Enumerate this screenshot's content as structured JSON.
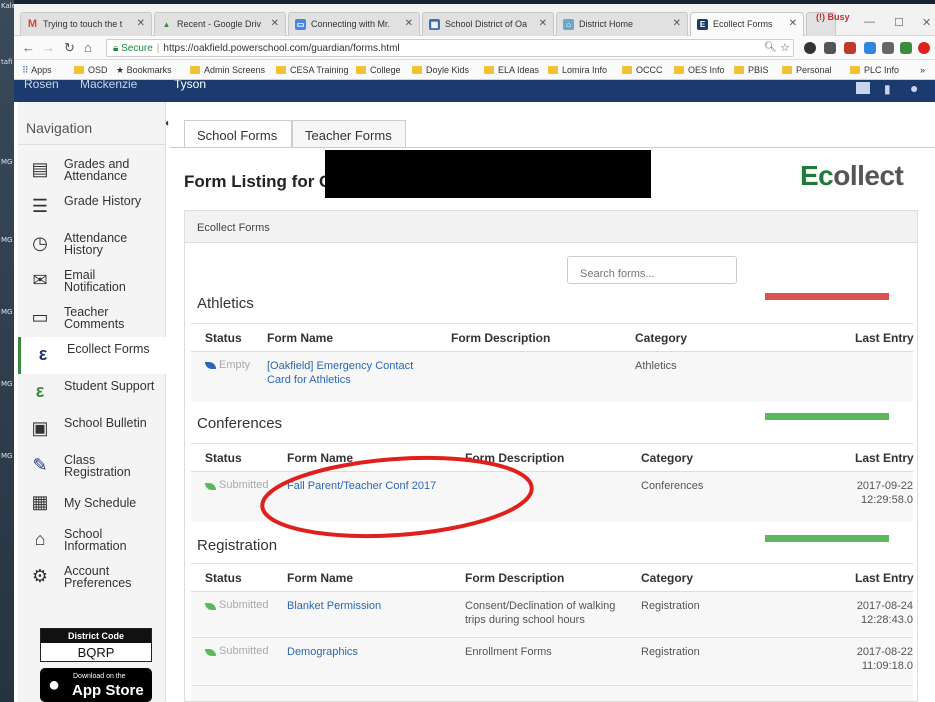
{
  "desktop": {
    "labels": [
      "Kale",
      "tafi",
      "MG",
      "MG",
      "MG",
      "MG",
      "MG"
    ]
  },
  "browser": {
    "tabs": [
      {
        "label": "Trying to touch the t",
        "icon": "gmail-icon",
        "icon_text": "M",
        "color": "#d44638"
      },
      {
        "label": "Recent - Google Driv",
        "icon": "google-drive-icon",
        "icon_text": "▲",
        "color": "#3b8d3b"
      },
      {
        "label": "Connecting with Mr.",
        "icon": "slides-icon",
        "icon_text": "▭",
        "color": "#4a86e8"
      },
      {
        "label": "School District of Oa",
        "icon": "school-site-icon",
        "icon_text": "▦",
        "color": "#3c6fb4"
      },
      {
        "label": "District Home",
        "icon": "district-home-icon",
        "icon_text": "⌂",
        "color": "#6aa7c9"
      },
      {
        "label": "Ecollect Forms",
        "icon": "ecollect-icon",
        "icon_text": "E",
        "color": "#1b3b6e"
      }
    ],
    "profile_label": "(!) Busy",
    "address": {
      "secure_label": "Secure",
      "url": "https://oakfield.powerschool.com/guardian/forms.html"
    },
    "bookmarks": [
      "Apps",
      "OSD",
      "Bookmarks",
      "Admin Screens",
      "CESA Training",
      "College",
      "Doyle Kids",
      "ELA Ideas",
      "Lomira Info",
      "OCCC",
      "OES Info",
      "PBIS",
      "Personal",
      "PLC Info"
    ]
  },
  "topbar": {
    "names": [
      "Rosen",
      "Mackenzie",
      "Tyson"
    ]
  },
  "sidebar": {
    "title": "Navigation",
    "items": [
      {
        "label": "Grades and Attendance",
        "icon": "grades-icon",
        "glyph": "▤"
      },
      {
        "label": "Grade History",
        "icon": "grade-history-icon",
        "glyph": "☰"
      },
      {
        "label": "Attendance History",
        "icon": "attendance-icon",
        "glyph": "◷"
      },
      {
        "label": "Email Notification",
        "icon": "email-icon",
        "glyph": "✉"
      },
      {
        "label": "Teacher Comments",
        "icon": "comments-icon",
        "glyph": "▭"
      },
      {
        "label": "Ecollect Forms",
        "icon": "ecollect-forms-icon",
        "glyph": "ε"
      },
      {
        "label": "Student Support",
        "icon": "student-support-icon",
        "glyph": "ε"
      },
      {
        "label": "School Bulletin",
        "icon": "bulletin-icon",
        "glyph": "▣"
      },
      {
        "label": "Class Registration",
        "icon": "registration-icon",
        "glyph": "✎"
      },
      {
        "label": "My Schedule",
        "icon": "schedule-icon",
        "glyph": "▦"
      },
      {
        "label": "School Information",
        "icon": "school-info-icon",
        "glyph": "⌂"
      },
      {
        "label": "Account Preferences",
        "icon": "account-icon",
        "glyph": "⚙"
      }
    ],
    "district_code_title": "District Code",
    "district_code": "BQRP",
    "app_store_small": "Download on the",
    "app_store_big": "App Store"
  },
  "main": {
    "tabs": [
      "School Forms",
      "Teacher Forms"
    ],
    "title": "Form Listing for C",
    "logo": {
      "accent": "Ec",
      "rest": "ollect"
    },
    "panel_title": "Ecollect Forms",
    "search_placeholder": "Search forms...",
    "columns": [
      "Status",
      "Form Name",
      "Form Description",
      "Category",
      "Last Entry"
    ],
    "sections": [
      {
        "name": "Athletics",
        "bar_color": "#d9534f",
        "rows": [
          {
            "status": "Empty",
            "name": "[Oakfield] Emergency Contact Card for Athletics",
            "description": "",
            "category": "Athletics",
            "last_entry": ""
          }
        ]
      },
      {
        "name": "Conferences",
        "bar_color": "#5cb85c",
        "rows": [
          {
            "status": "Submitted",
            "name": "Fall Parent/Teacher Conf 2017",
            "description": "",
            "category": "Conferences",
            "last_entry": "2017-09-22 12:29:58.0"
          }
        ]
      },
      {
        "name": "Registration",
        "bar_color": "#5cb85c",
        "rows": [
          {
            "status": "Submitted",
            "name": "Blanket Permission",
            "description": "Consent/Declination of walking trips during school hours",
            "category": "Registration",
            "last_entry": "2017-08-24 12:28:43.0"
          },
          {
            "status": "Submitted",
            "name": "Demographics",
            "description": "Enrollment Forms",
            "category": "Registration",
            "last_entry": "2017-08-22 11:09:18.0"
          }
        ]
      }
    ]
  },
  "colors": {
    "annotation": "#e0201c",
    "leaf_empty": "#2b67b5",
    "leaf_submitted": "#5cb85c"
  }
}
